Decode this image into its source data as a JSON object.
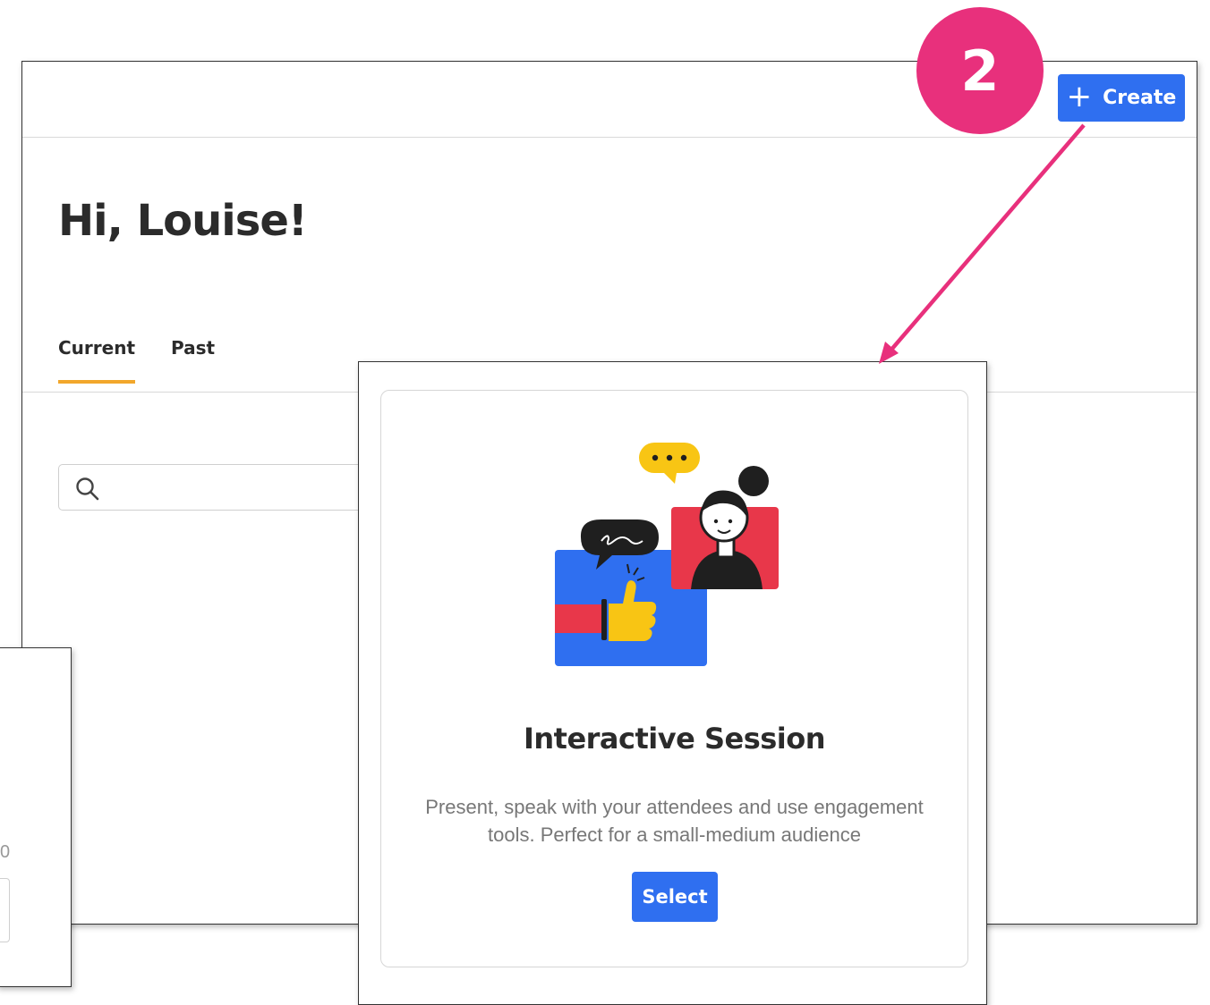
{
  "header": {
    "create_label": "Create"
  },
  "greeting": "Hi, Louise!",
  "tabs": [
    {
      "label": "Current",
      "active": true
    },
    {
      "label": "Past",
      "active": false
    }
  ],
  "search": {
    "placeholder": ""
  },
  "background_panel": {
    "partial_text": "0"
  },
  "card": {
    "title": "Interactive Session",
    "description": "Present, speak with your attendees and use engagement tools. Perfect for a small-medium audience",
    "select_label": "Select"
  },
  "annotation": {
    "step_number": "2",
    "color": "#e8307c"
  },
  "colors": {
    "primary": "#2f6ff0",
    "tab_underline": "#f2a72b"
  },
  "icons": [
    "plus-icon",
    "search-icon",
    "interactive-session-illustration",
    "arrow-annotation"
  ]
}
